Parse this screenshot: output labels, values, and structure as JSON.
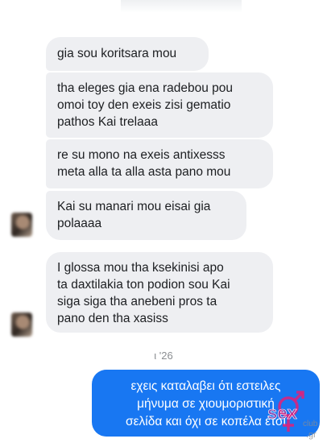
{
  "messages_in": [
    {
      "lines": [
        "gia sou koritsara mou"
      ]
    },
    {
      "lines": [
        "tha eleges gia ena radebou  pou",
        "omoi toy den exeis zisi gematio",
        "pathos Kai trelaaa"
      ]
    },
    {
      "lines": [
        "re su mono na exeis antixesss",
        "meta alla ta alla asta pano mou"
      ]
    },
    {
      "lines": [
        "Kai su manari mou eisai gia",
        "polaaaa"
      ]
    },
    {
      "lines": [
        "I glossa mou tha ksekinisi apo",
        "ta daxtilakia ton podion sou Kai",
        "siga siga tha anebeni pros ta",
        "pano den tha xasiss"
      ]
    }
  ],
  "timestamp": "ι '26",
  "message_out": {
    "lines": [
      "εχεις καταλαβει ότι εστειλες",
      "μήνυμα σε χιουμοριστική",
      "σελίδα και όχι σε κοπέλα έτσι"
    ]
  },
  "watermark": {
    "brand": "sex",
    "suffix": "club",
    "tld": ".gr"
  },
  "colors": {
    "incoming_bubble": "#eeeff2",
    "outgoing_bubble": "#1877f2",
    "watermark_pink": "#e2207a"
  },
  "icons": {
    "avatar": "blurred-profile-photo",
    "watermark_symbol": "female-male-symbol"
  }
}
